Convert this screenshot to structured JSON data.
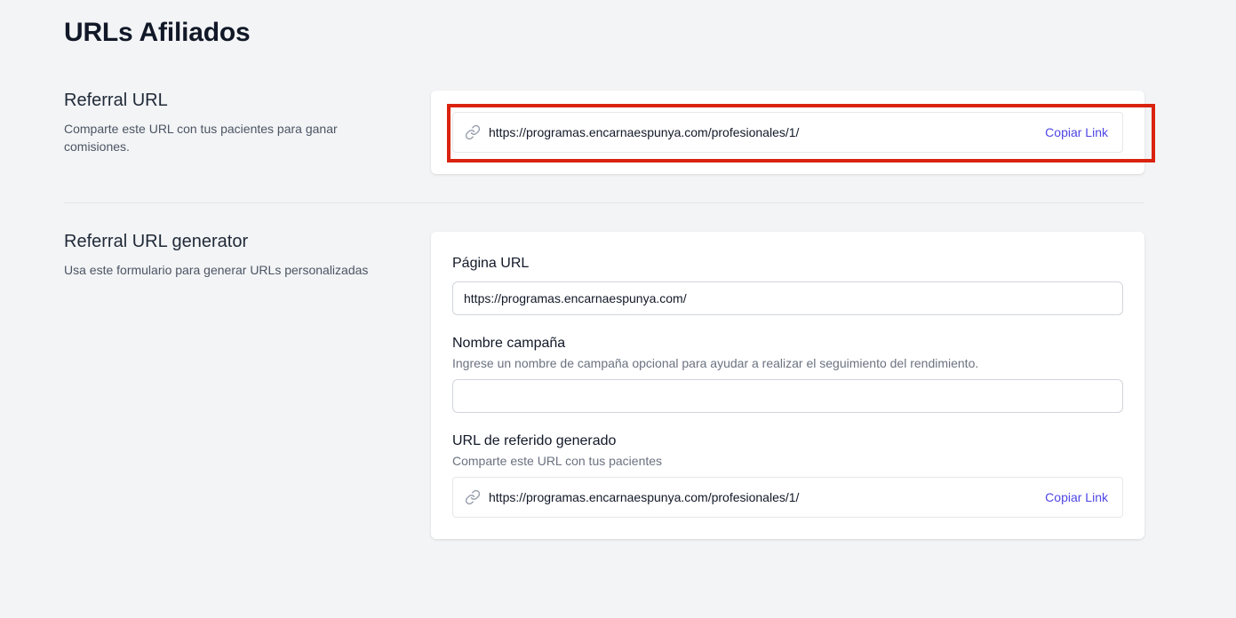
{
  "page": {
    "title": "URLs Afiliados"
  },
  "referral": {
    "title": "Referral URL",
    "description": "Comparte este URL con tus pacientes para ganar comisiones.",
    "url": "https://programas.encarnaespunya.com/profesionales/1/",
    "copy_label": "Copiar Link"
  },
  "generator": {
    "title": "Referral URL generator",
    "description": "Usa este formulario para generar URLs personalizadas",
    "page_url": {
      "label": "Página URL",
      "value": "https://programas.encarnaespunya.com/"
    },
    "campaign": {
      "label": "Nombre campaña",
      "help": "Ingrese un nombre de campaña opcional para ayudar a realizar el seguimiento del rendimiento.",
      "value": ""
    },
    "generated": {
      "label": "URL de referido generado",
      "help": "Comparte este URL con tus pacientes",
      "url": "https://programas.encarnaespunya.com/profesionales/1/",
      "copy_label": "Copiar Link"
    }
  },
  "colors": {
    "background": "#f3f4f6",
    "accent": "#4f46e5",
    "highlight": "#d9230f"
  },
  "icons": {
    "link": "link-icon"
  }
}
